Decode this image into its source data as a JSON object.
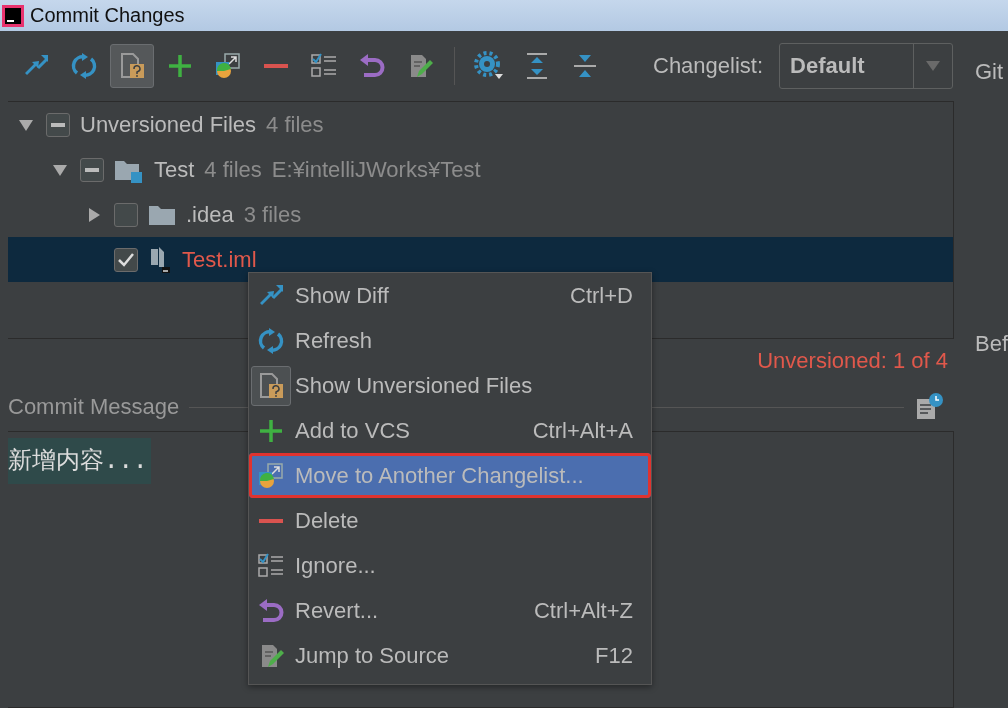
{
  "window": {
    "title": "Commit Changes"
  },
  "toolbar": {
    "buttons": [
      {
        "kind": "diff",
        "on": false
      },
      {
        "kind": "refresh",
        "on": false
      },
      {
        "kind": "unversioned",
        "on": true
      },
      {
        "kind": "add",
        "on": false
      },
      {
        "kind": "move",
        "on": false
      },
      {
        "kind": "delete",
        "on": false
      },
      {
        "kind": "ignore",
        "on": false
      },
      {
        "kind": "revert",
        "on": false
      },
      {
        "kind": "jump",
        "on": false
      },
      {
        "kind": "separator"
      },
      {
        "kind": "settings",
        "on": false
      },
      {
        "kind": "expand",
        "on": false
      },
      {
        "kind": "collapse",
        "on": false
      }
    ],
    "changelist_label": "Changelist:",
    "changelist_value": "Default"
  },
  "right_panel": {
    "top_label": "Git",
    "bottom_label": "Bef"
  },
  "tree": [
    {
      "label": "Unversioned Files",
      "count": "4 files",
      "checked": false,
      "mixed": true,
      "expanded": true,
      "selected": false,
      "color": "#bbbbbb",
      "children": [
        {
          "kind": "module",
          "label": "Test",
          "count": "4 files",
          "path": "E:¥intelliJWorks¥Test",
          "checked": false,
          "mixed": true,
          "expanded": true,
          "selected": false,
          "color": "#bbbbbb",
          "children": [
            {
              "kind": "folder",
              "label": ".idea",
              "count": "3 files",
              "checked": false,
              "mixed": false,
              "expanded": false,
              "selected": false,
              "color": "#bbbbbb"
            },
            {
              "kind": "file",
              "label": "Test.iml",
              "checked": true,
              "mixed": false,
              "selected": true,
              "color": "#e0584b"
            }
          ]
        }
      ]
    }
  ],
  "status": "Unversioned: 1 of 4",
  "commit_message": {
    "label": "Commit Message",
    "value": "新增内容..."
  },
  "context_menu": [
    {
      "kind": "diff",
      "label": "Show Diff",
      "shortcut": "Ctrl+D",
      "selected": false,
      "on": false
    },
    {
      "kind": "refresh",
      "label": "Refresh",
      "selected": false,
      "on": false
    },
    {
      "kind": "unversioned",
      "label": "Show Unversioned Files",
      "selected": false,
      "on": true
    },
    {
      "kind": "add",
      "label": "Add to VCS",
      "shortcut": "Ctrl+Alt+A",
      "selected": false,
      "on": false
    },
    {
      "kind": "move",
      "label": "Move to Another Changelist...",
      "selected": true,
      "on": false
    },
    {
      "kind": "delete",
      "label": "Delete",
      "selected": false,
      "on": false
    },
    {
      "kind": "ignore",
      "label": "Ignore...",
      "selected": false,
      "on": false
    },
    {
      "kind": "revert",
      "label": "Revert...",
      "shortcut": "Ctrl+Alt+Z",
      "selected": false,
      "on": false
    },
    {
      "kind": "jump",
      "label": "Jump to Source",
      "shortcut": "F12",
      "selected": false,
      "on": false
    }
  ]
}
